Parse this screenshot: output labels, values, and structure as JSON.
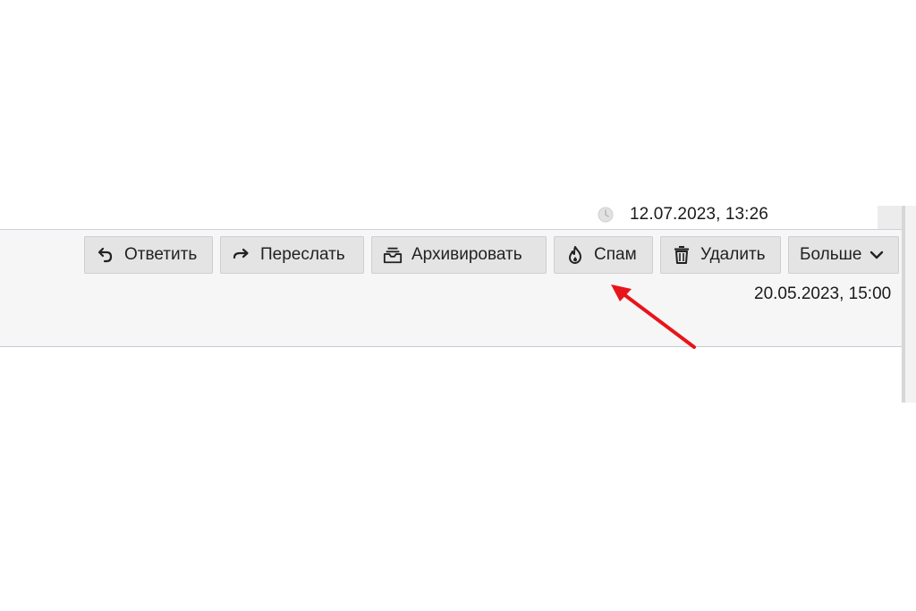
{
  "messages": {
    "received_date": "12.07.2023, 13:26",
    "header_date": "20.05.2023, 15:00"
  },
  "toolbar": {
    "reply_label": "Ответить",
    "forward_label": "Переслать",
    "archive_label": "Архивировать",
    "spam_label": "Спам",
    "delete_label": "Удалить",
    "more_label": "Больше"
  },
  "icons": {
    "clock": "clock-icon",
    "reply": "reply-icon",
    "forward": "forward-icon",
    "archive": "archive-icon",
    "spam": "flame-icon",
    "delete": "trash-icon",
    "more": "chevron-down-icon"
  },
  "colors": {
    "annotation_arrow": "#e8141b",
    "button_bg": "#e4e4e4",
    "header_bg": "#f6f6f6"
  }
}
